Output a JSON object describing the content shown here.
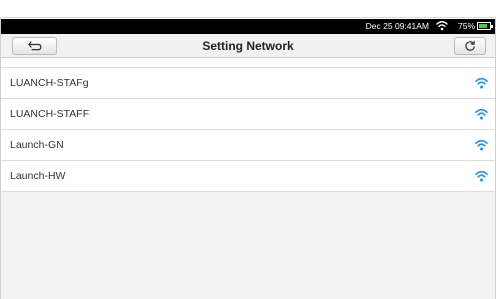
{
  "status_bar": {
    "time": "Dec 25 09:41AM",
    "battery_percent": "75%",
    "battery_level": 0.75,
    "wifi_icon": "wifi-icon",
    "battery_color": "#3fd047"
  },
  "header": {
    "title": "Setting Network",
    "back_icon": "back-arrow-icon",
    "refresh_icon": "refresh-icon"
  },
  "networks": [
    {
      "ssid": "LUANCH-STAFg",
      "icon": "wifi-signal-icon"
    },
    {
      "ssid": "LUANCH-STAFF",
      "icon": "wifi-signal-icon"
    },
    {
      "ssid": "Launch-GN",
      "icon": "wifi-signal-icon"
    },
    {
      "ssid": "Launch-HW",
      "icon": "wifi-signal-icon"
    }
  ],
  "colors": {
    "wifi_signal": "#1e90ff",
    "header_bg": "#f1f1f1",
    "status_bar_bg": "#000000"
  }
}
